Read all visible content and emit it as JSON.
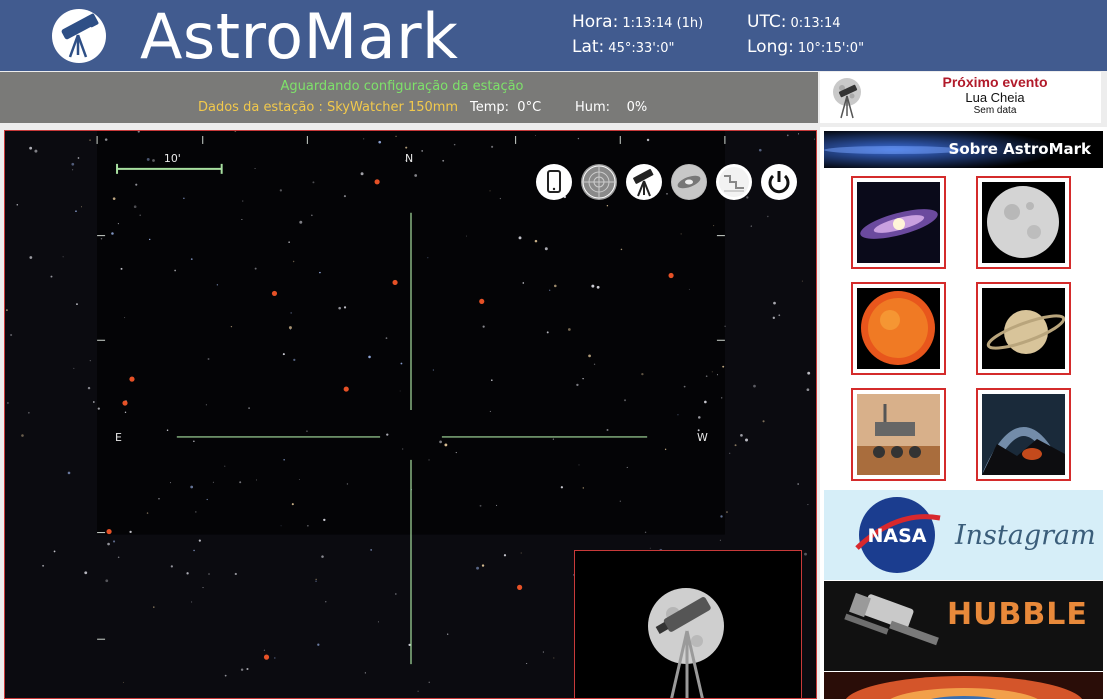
{
  "header": {
    "brand": "AstroMark",
    "time_label": "Hora:",
    "time_value": "1:13:14 (1h)",
    "utc_label": "UTC:",
    "utc_value": "0:13:14",
    "lat_label": "Lat:",
    "lat_value": "45°:33':0\"",
    "long_label": "Long:",
    "long_value": "10°:15':0\""
  },
  "status": {
    "message": "Aguardando configuração da estação",
    "station": "Dados da estação : SkyWatcher 150mm",
    "temp_label": "Temp:",
    "temp_value": "0°C",
    "hum_label": "Hum:",
    "hum_value": "0%"
  },
  "next_event": {
    "title": "Próximo evento",
    "name": "Lua Cheia",
    "date": "Sem data"
  },
  "sky": {
    "scale_label": "10'",
    "north": "N",
    "east": "E",
    "west": "W",
    "tools": [
      "mobile-icon",
      "radar-icon",
      "telescope-icon",
      "galaxy-icon",
      "chart-icon",
      "power-icon"
    ]
  },
  "sidebar": {
    "about_label": "Sobre AstroMark",
    "thumbs": [
      "galaxy",
      "moon",
      "sun",
      "saturn",
      "mars-rover",
      "milky-way-arch"
    ],
    "instagram_label": "Instagram",
    "hubble_label": "HUBBLE"
  },
  "colors": {
    "header_bg": "#415b8f",
    "status_bg": "#7a7a78",
    "status_green": "#7ee26a",
    "status_yellow": "#f2c94c",
    "event_red": "#b11a2a",
    "panel_border": "#c83a3a",
    "reticle": "#a8e0a0"
  }
}
